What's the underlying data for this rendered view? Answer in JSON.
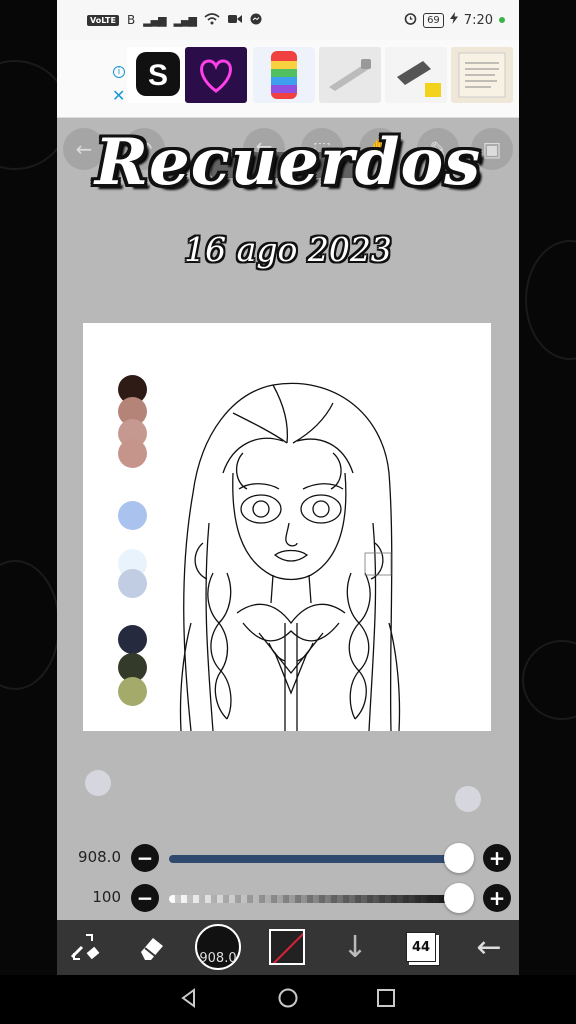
{
  "status_bar": {
    "network_badge": "VoLTE",
    "sim_label": "B",
    "battery": "69",
    "time": "7:20"
  },
  "ad": {
    "info_icon": "info-icon",
    "close_icon": "close-icon",
    "thumb_colors": [
      "#111111",
      "#3a1060",
      "#e8f0ff",
      "#e6e6e6",
      "#f2f2f2",
      "#efe8d8"
    ]
  },
  "overlay": {
    "title": "Recuerdos",
    "date": "16 ago 2023"
  },
  "palette": {
    "swatches": [
      "#2f1b16",
      "#b58478",
      "#c69990",
      "#c5958c",
      "#a9c3ee",
      "#e9f3fb",
      "#c0cde3",
      "#262a3e",
      "#333a29",
      "#a4aa6a"
    ]
  },
  "sliders": {
    "brush_size": {
      "value_label": "908.0",
      "level": 1.0,
      "fill_color": "#2f4a6e",
      "minus": "−",
      "plus": "+"
    },
    "opacity": {
      "value_label": "100",
      "level": 1.0,
      "minus": "−",
      "plus": "+"
    }
  },
  "toolbar_bottom": {
    "brush_size_label": "908.0",
    "layers_count": "44"
  },
  "colors": {
    "accent_red": "#e0203a",
    "tool_bar_bg": "#353535"
  }
}
